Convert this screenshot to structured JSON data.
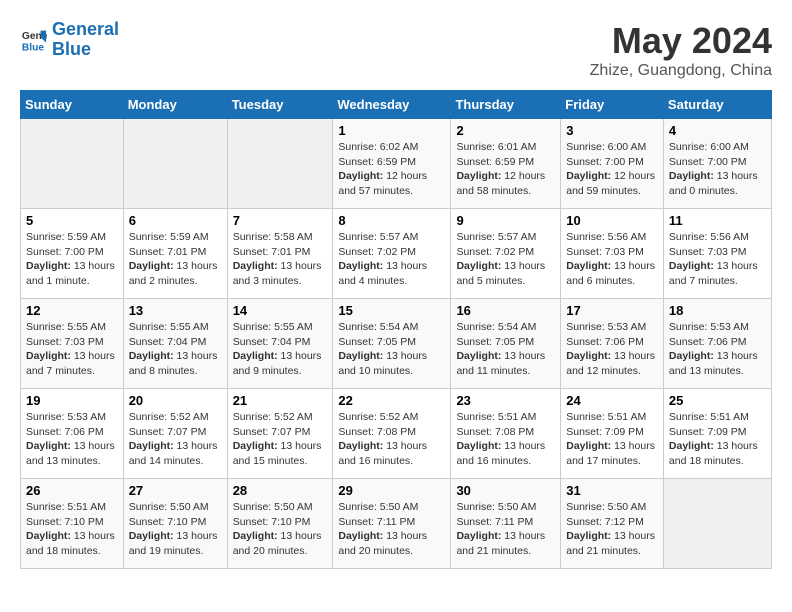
{
  "header": {
    "logo_line1": "General",
    "logo_line2": "Blue",
    "title": "May 2024",
    "subtitle": "Zhize, Guangdong, China"
  },
  "days_of_week": [
    "Sunday",
    "Monday",
    "Tuesday",
    "Wednesday",
    "Thursday",
    "Friday",
    "Saturday"
  ],
  "weeks": [
    [
      {
        "day": "",
        "info": ""
      },
      {
        "day": "",
        "info": ""
      },
      {
        "day": "",
        "info": ""
      },
      {
        "day": "1",
        "info": "Sunrise: 6:02 AM\nSunset: 6:59 PM\nDaylight: 12 hours and 57 minutes."
      },
      {
        "day": "2",
        "info": "Sunrise: 6:01 AM\nSunset: 6:59 PM\nDaylight: 12 hours and 58 minutes."
      },
      {
        "day": "3",
        "info": "Sunrise: 6:00 AM\nSunset: 7:00 PM\nDaylight: 12 hours and 59 minutes."
      },
      {
        "day": "4",
        "info": "Sunrise: 6:00 AM\nSunset: 7:00 PM\nDaylight: 13 hours and 0 minutes."
      }
    ],
    [
      {
        "day": "5",
        "info": "Sunrise: 5:59 AM\nSunset: 7:00 PM\nDaylight: 13 hours and 1 minute."
      },
      {
        "day": "6",
        "info": "Sunrise: 5:59 AM\nSunset: 7:01 PM\nDaylight: 13 hours and 2 minutes."
      },
      {
        "day": "7",
        "info": "Sunrise: 5:58 AM\nSunset: 7:01 PM\nDaylight: 13 hours and 3 minutes."
      },
      {
        "day": "8",
        "info": "Sunrise: 5:57 AM\nSunset: 7:02 PM\nDaylight: 13 hours and 4 minutes."
      },
      {
        "day": "9",
        "info": "Sunrise: 5:57 AM\nSunset: 7:02 PM\nDaylight: 13 hours and 5 minutes."
      },
      {
        "day": "10",
        "info": "Sunrise: 5:56 AM\nSunset: 7:03 PM\nDaylight: 13 hours and 6 minutes."
      },
      {
        "day": "11",
        "info": "Sunrise: 5:56 AM\nSunset: 7:03 PM\nDaylight: 13 hours and 7 minutes."
      }
    ],
    [
      {
        "day": "12",
        "info": "Sunrise: 5:55 AM\nSunset: 7:03 PM\nDaylight: 13 hours and 7 minutes."
      },
      {
        "day": "13",
        "info": "Sunrise: 5:55 AM\nSunset: 7:04 PM\nDaylight: 13 hours and 8 minutes."
      },
      {
        "day": "14",
        "info": "Sunrise: 5:55 AM\nSunset: 7:04 PM\nDaylight: 13 hours and 9 minutes."
      },
      {
        "day": "15",
        "info": "Sunrise: 5:54 AM\nSunset: 7:05 PM\nDaylight: 13 hours and 10 minutes."
      },
      {
        "day": "16",
        "info": "Sunrise: 5:54 AM\nSunset: 7:05 PM\nDaylight: 13 hours and 11 minutes."
      },
      {
        "day": "17",
        "info": "Sunrise: 5:53 AM\nSunset: 7:06 PM\nDaylight: 13 hours and 12 minutes."
      },
      {
        "day": "18",
        "info": "Sunrise: 5:53 AM\nSunset: 7:06 PM\nDaylight: 13 hours and 13 minutes."
      }
    ],
    [
      {
        "day": "19",
        "info": "Sunrise: 5:53 AM\nSunset: 7:06 PM\nDaylight: 13 hours and 13 minutes."
      },
      {
        "day": "20",
        "info": "Sunrise: 5:52 AM\nSunset: 7:07 PM\nDaylight: 13 hours and 14 minutes."
      },
      {
        "day": "21",
        "info": "Sunrise: 5:52 AM\nSunset: 7:07 PM\nDaylight: 13 hours and 15 minutes."
      },
      {
        "day": "22",
        "info": "Sunrise: 5:52 AM\nSunset: 7:08 PM\nDaylight: 13 hours and 16 minutes."
      },
      {
        "day": "23",
        "info": "Sunrise: 5:51 AM\nSunset: 7:08 PM\nDaylight: 13 hours and 16 minutes."
      },
      {
        "day": "24",
        "info": "Sunrise: 5:51 AM\nSunset: 7:09 PM\nDaylight: 13 hours and 17 minutes."
      },
      {
        "day": "25",
        "info": "Sunrise: 5:51 AM\nSunset: 7:09 PM\nDaylight: 13 hours and 18 minutes."
      }
    ],
    [
      {
        "day": "26",
        "info": "Sunrise: 5:51 AM\nSunset: 7:10 PM\nDaylight: 13 hours and 18 minutes."
      },
      {
        "day": "27",
        "info": "Sunrise: 5:50 AM\nSunset: 7:10 PM\nDaylight: 13 hours and 19 minutes."
      },
      {
        "day": "28",
        "info": "Sunrise: 5:50 AM\nSunset: 7:10 PM\nDaylight: 13 hours and 20 minutes."
      },
      {
        "day": "29",
        "info": "Sunrise: 5:50 AM\nSunset: 7:11 PM\nDaylight: 13 hours and 20 minutes."
      },
      {
        "day": "30",
        "info": "Sunrise: 5:50 AM\nSunset: 7:11 PM\nDaylight: 13 hours and 21 minutes."
      },
      {
        "day": "31",
        "info": "Sunrise: 5:50 AM\nSunset: 7:12 PM\nDaylight: 13 hours and 21 minutes."
      },
      {
        "day": "",
        "info": ""
      }
    ]
  ]
}
